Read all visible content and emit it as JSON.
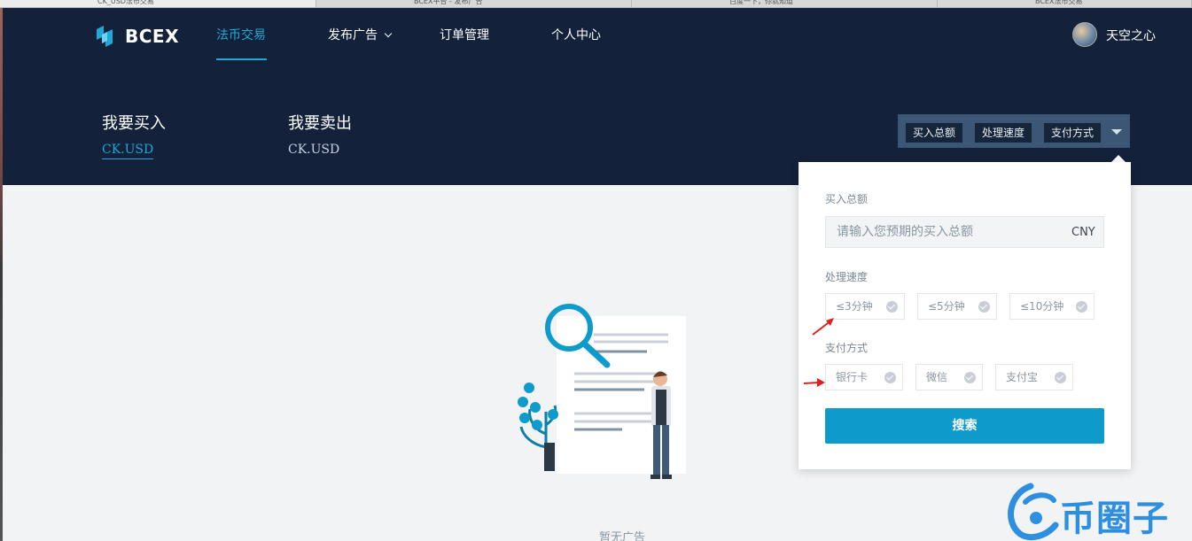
{
  "browser": {
    "tabs": [
      {
        "label": "CK_USD法币交易"
      },
      {
        "label": "BCEX平台 - 发布广告"
      },
      {
        "label": "百度一下，你就知道"
      },
      {
        "label": "BCEX法币交易"
      }
    ]
  },
  "nav": {
    "logo_text": "BCEX",
    "items": [
      {
        "label": "法币交易",
        "active": true
      },
      {
        "label": "发布广告",
        "has_dropdown": true
      },
      {
        "label": "订单管理"
      },
      {
        "label": "个人中心"
      }
    ],
    "user": {
      "name": "天空之心"
    }
  },
  "trade": {
    "buy": {
      "title": "我要买入",
      "coin": "CK.USD"
    },
    "sell": {
      "title": "我要卖出",
      "coin": "CK.USD"
    }
  },
  "filters": {
    "chips": [
      "买入总额",
      "处理速度",
      "支付方式"
    ]
  },
  "dropdown": {
    "amount_label": "买入总额",
    "amount_placeholder": "请输入您预期的买入总额",
    "amount_unit": "CNY",
    "speed_label": "处理速度",
    "speed_options": [
      "≤3分钟",
      "≤5分钟",
      "≤10分钟"
    ],
    "payment_label": "支付方式",
    "payment_options": [
      "银行卡",
      "微信",
      "支付宝"
    ],
    "search_label": "搜索"
  },
  "empty": {
    "text": "暂无广告"
  },
  "watermark": {
    "text": "币圈子"
  },
  "colors": {
    "nav_bg": "#13223a",
    "accent": "#1ea9d8",
    "button": "#0e9bcc",
    "page_bg": "#f2f3f5",
    "annotation": "#e02020"
  }
}
